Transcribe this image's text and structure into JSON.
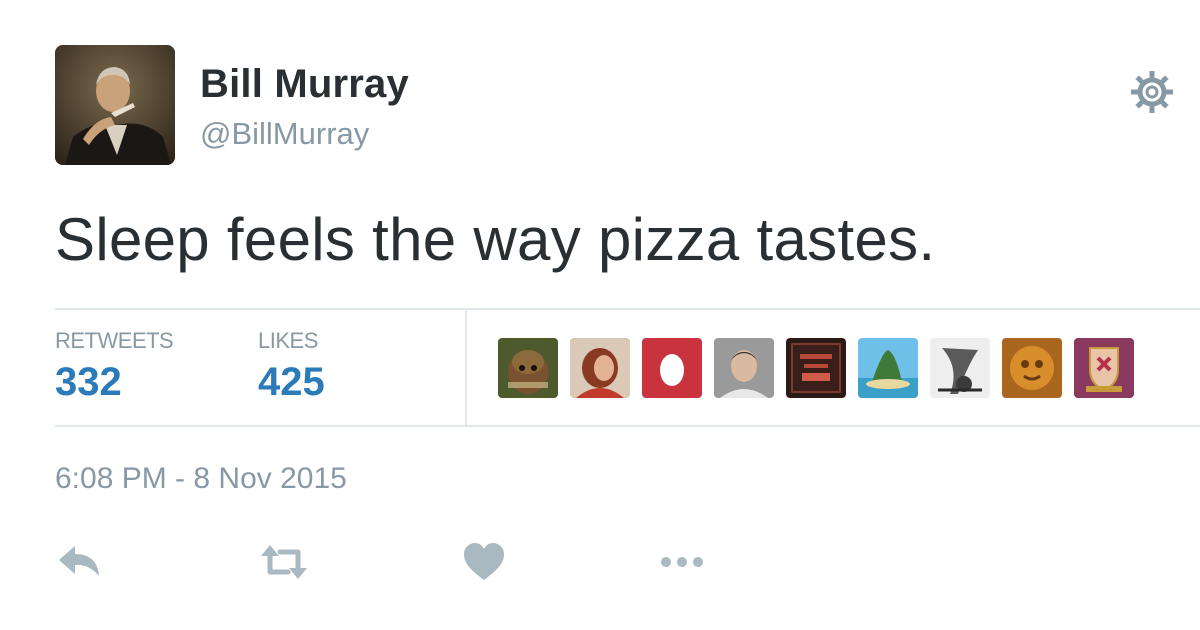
{
  "user": {
    "display_name": "Bill Murray",
    "handle": "@BillMurray",
    "avatar_icon": "profile-photo"
  },
  "tweet": {
    "text": "Sleep feels the way pizza tastes."
  },
  "stats": {
    "retweets_label": "RETWEETS",
    "retweets_count": "332",
    "likes_label": "LIKES",
    "likes_count": "425"
  },
  "likers": [
    {
      "icon": "ewok-avatar"
    },
    {
      "icon": "person-red-hair-avatar"
    },
    {
      "icon": "egg-avatar"
    },
    {
      "icon": "man-portrait-avatar"
    },
    {
      "icon": "poster-avatar"
    },
    {
      "icon": "island-avatar"
    },
    {
      "icon": "sketch-avatar"
    },
    {
      "icon": "golden-face-avatar"
    },
    {
      "icon": "crest-avatar"
    }
  ],
  "timestamp": "6:08 PM - 8 Nov 2015",
  "actions": {
    "reply_icon": "reply-icon",
    "retweet_icon": "retweet-icon",
    "like_icon": "heart-icon",
    "more_icon": "more-icon"
  },
  "colors": {
    "text": "#292f33",
    "muted": "#8899a6",
    "accent": "#2b7bb9",
    "divider": "#e1e8ed",
    "action_icon": "#aab8c2"
  }
}
